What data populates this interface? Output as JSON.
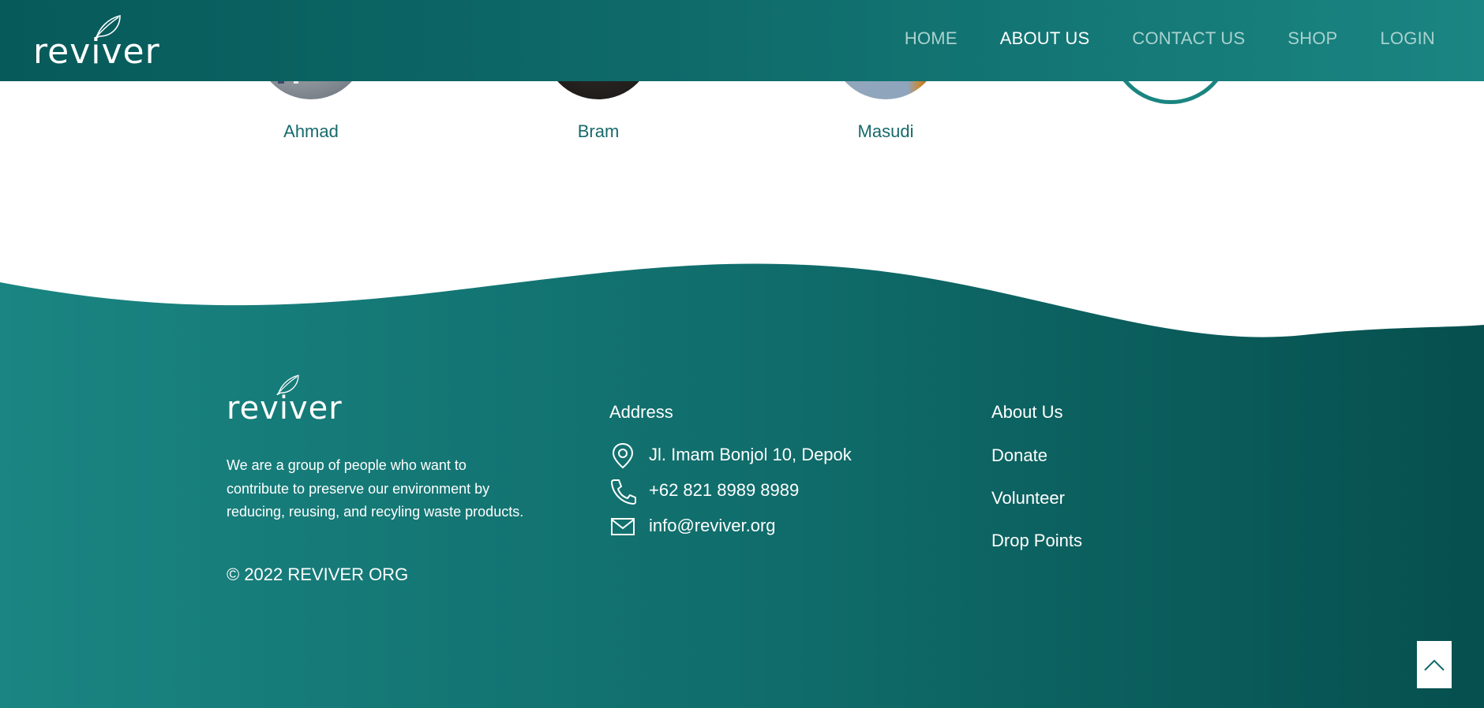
{
  "brand": {
    "name": "reviver"
  },
  "nav": {
    "items": [
      {
        "label": "HOME"
      },
      {
        "label": "ABOUT US",
        "active": true
      },
      {
        "label": "CONTACT US"
      },
      {
        "label": "SHOP"
      },
      {
        "label": "LOGIN"
      }
    ]
  },
  "team": {
    "members": [
      {
        "name": "Ahmad"
      },
      {
        "name": "Bram"
      },
      {
        "name": "Masudi"
      }
    ]
  },
  "footer": {
    "about_text": "We are a group of people who want to contribute to preserve our environment by reducing, reusing, and recyling waste products.",
    "copyright": "© 2022 REVIVER ORG",
    "address_title": "Address",
    "address": "Jl. Imam Bonjol 10, Depok",
    "phone": "+62 821 8989 8989",
    "email": "info@reviver.org",
    "links": [
      "About Us",
      "Donate",
      "Volunteer",
      "Drop Points"
    ]
  },
  "icons": {
    "location": "location-pin-icon",
    "phone": "phone-icon",
    "email": "envelope-icon",
    "scroll_top": "chevron-up-icon"
  },
  "colors": {
    "primary": "#0e6a69",
    "accent_light": "#1a8582",
    "nav_inactive": "#a9d2cf",
    "name_text": "#176a6b"
  }
}
